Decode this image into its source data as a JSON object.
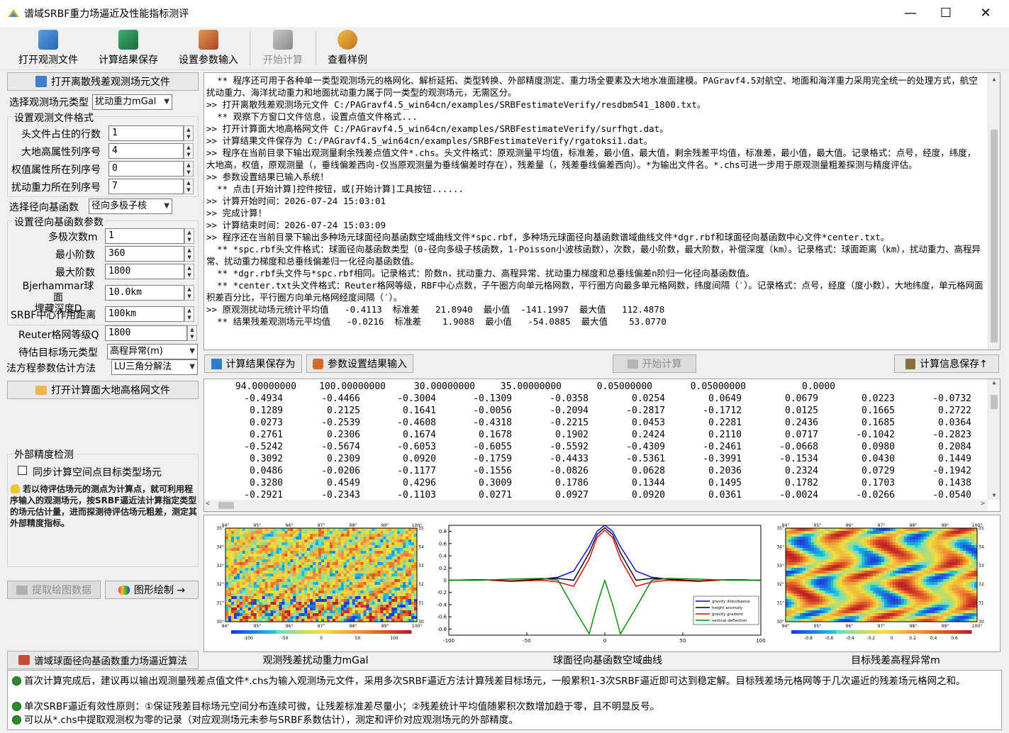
{
  "window": {
    "title": "谱域SRBF重力场逼近及性能指标测评",
    "minimize": "—",
    "maximize": "☐",
    "close": "✕"
  },
  "toolbar": {
    "items": [
      {
        "label": "打开观测文件",
        "icon": "open-file-icon",
        "enabled": true
      },
      {
        "label": "计算结果保存",
        "icon": "save-icon",
        "enabled": true
      },
      {
        "label": "设置参数输入",
        "icon": "settings-icon",
        "enabled": true
      },
      {
        "label": "开始计算",
        "icon": "computer-icon",
        "enabled": false
      },
      {
        "label": "查看样例",
        "icon": "example-icon",
        "enabled": true
      }
    ]
  },
  "left": {
    "open_residual_button": "打开离散残差观测场元文件",
    "field_type_label": "选择观测场元类型",
    "field_type_value": "扰动重力mGal",
    "format_group_title": "设置观测文件格式",
    "header_rows_label": "头文件占住的行数",
    "header_rows_value": "1",
    "height_col_label": "大地高属性列序号",
    "height_col_value": "4",
    "weight_col_label": "权值属性所在列序号",
    "weight_col_value": "0",
    "gravity_col_label": "扰动重力所在列序号",
    "gravity_col_value": "7",
    "basis_label": "选择径向基函数",
    "basis_value": "径向多极子核",
    "basis_group_title": "设置径向基函数参数",
    "multipole_label": "多极次数m",
    "multipole_value": "1",
    "min_order_label": "最小阶数",
    "min_order_value": "360",
    "max_order_label": "最大阶数",
    "max_order_value": "1800",
    "bjerhammar_label": "Bjerhammar球面\n埋藏深度D",
    "bjerhammar_value": "10.0km",
    "srbf_range_label": "SRBF中心作用距离",
    "srbf_range_value": "100km",
    "reuter_label": "Reuter格网等级Q",
    "reuter_value": "1800",
    "target_label": "待估目标场元类型",
    "target_value": "高程异常(m)",
    "method_label": "法方程参数估计方法",
    "method_value": "LU三角分解法",
    "open_grid_button": "打开计算面大地高格网文件",
    "external_group_title": "外部精度检测",
    "sync_checkbox_label": "同步计算空间点目标类型场元",
    "sync_checked": false,
    "hint": "若以待评估场元的测点为计算点，就可利用程序输入的观测场元，按SRBF逼近法计算指定类型的场元估计量，进而探测待评估场元粗差，测定其外部精度指标。",
    "extract_button": "提取绘图数据",
    "plot_button": "图形绘制 →",
    "algorithm_button": "谱域球面径向基函数重力场逼近算法"
  },
  "log": {
    "lines": [
      "  ** 程序还可用于各种单一类型观测场元的格网化、解析延拓、类型转换、外部精度测定、重力场全要素及大地水准面建模。PAGravf4.5对航空、地面和海洋重力采用完全统一的处理方式，航空扰动重力、海洋扰动重力和地面扰动重力属于同一类型的观测场元，无需区分。",
      ">> 打开离散残差观测场元文件 C:/PAGravf4.5_win64cn/examples/SRBFestimateVerify/resdbm541_1800.txt。",
      "  ** 观察下方窗口文件信息，设置点值文件格式...",
      ">> 打开计算面大地高格网文件 C:/PAGravf4.5_win64cn/examples/SRBFestimateVerify/surfhgt.dat。",
      ">> 计算结果文件保存为 C:/PAGravf4.5_win64cn/examples/SRBFestimateVerify/rgatoksi1.dat。",
      ">> 程序在当前目录下输出观测量剩余残差点值文件*.chs。头文件格式：原观测量平均值，标准差，最小值，最大值，剩余残差平均值，标准差，最小值，最大值。记录格式：点号，经度，纬度，大地高，权值，原观测量（，垂线偏差西向-仅当原观测量为垂线偏差时存在），残差量（，残差垂线偏差西向）。*为输出文件名。*.chs可进一步用于原观测量粗差探测与精度评估。",
      ">> 参数设置结果已输入系统！",
      "  ** 点击[开始计算]控件按钮，或[开始计算]工具按钮......",
      ">> 计算开始时间：2026-07-24 15:03:01",
      ">> 完成计算！",
      ">> 计算结束时间：2026-07-24 15:03:09",
      ">> 程序还在当前目录下输出多种场元球面径向基函数空域曲线文件*spc.rbf，多种场元球面径向基函数谱域曲线文件*dgr.rbf和球面径向基函数中心文件*center.txt。",
      "  ** *spc.rbf头文件格式：球面径向基函数类型（0-径向多级子核函数，1-Poisson小波核函数），次数，最小阶数，最大阶数，补偿深度（km）。记录格式：球面距离（km），扰动重力、高程异常、扰动重力梯度和总垂线偏差归一化径向基函数值。",
      "  ** *dgr.rbf头文件与*spc.rbf相同。记录格式：阶数n，扰动重力、高程异常、扰动重力梯度和总垂线偏差n阶归一化径向基函数值。",
      "  ** *center.txt头文件格式：Reuter格网等级，RBF中心点数，子午圈方向单元格网数，平行圈方向最多单元格网数，纬度间隔（′）。记录格式：点号，经度（度小数），大地纬度，单元格网面积差百分比，平行圈方向单元格网经度间隔（′）。",
      ">> 原观测扰动场元统计平均值   -0.4113  标准差   21.8940  最小值  -141.1997  最大值   112.4878",
      "  ** 结果残差观测场元平均值   -0.0216  标准差    1.9088  最小值   -54.0885  最大值    53.0770"
    ]
  },
  "midbar": {
    "save_result_button": "计算结果保存为",
    "params_input_button": "参数设置结果输入",
    "start_button": "开始计算",
    "save_info_button": "计算信息保存↑"
  },
  "grid": {
    "header": [
      "94.00000000",
      "100.00000000",
      "30.00000000",
      "35.00000000",
      "0.05000000",
      "0.05000000",
      "0.0000"
    ],
    "rows": [
      [
        "-0.4934",
        "-0.4466",
        "-0.3004",
        "-0.1309",
        "-0.0358",
        "0.0254",
        "0.0649",
        "0.0679",
        "0.0223",
        "-0.0732"
      ],
      [
        "0.1289",
        "0.2125",
        "0.1641",
        "-0.0056",
        "-0.2094",
        "-0.2817",
        "-0.1712",
        "0.0125",
        "0.1665",
        "0.2722"
      ],
      [
        "0.0273",
        "-0.2539",
        "-0.4608",
        "-0.4318",
        "-0.2215",
        "0.0453",
        "0.2281",
        "0.2436",
        "0.1685",
        "0.0364"
      ],
      [
        "0.2761",
        "0.2306",
        "0.1674",
        "0.1678",
        "0.1902",
        "0.2424",
        "0.2110",
        "0.0717",
        "-0.1042",
        "-0.2823"
      ],
      [
        "-0.5242",
        "-0.5674",
        "-0.6053",
        "-0.6055",
        "-0.5592",
        "-0.4309",
        "-0.2461",
        "-0.0668",
        "0.0980",
        "0.2084"
      ],
      [
        "0.3092",
        "0.2309",
        "0.0920",
        "-0.1759",
        "-0.4433",
        "-0.5361",
        "-0.3991",
        "-0.1534",
        "0.0430",
        "0.1449"
      ],
      [
        "0.0486",
        "-0.0206",
        "-0.1177",
        "-0.1556",
        "-0.0826",
        "0.0628",
        "0.2036",
        "0.2324",
        "0.0729",
        "-0.1942"
      ],
      [
        "0.3280",
        "0.4549",
        "0.4296",
        "0.3009",
        "0.1786",
        "0.1344",
        "0.1495",
        "0.1782",
        "0.1703",
        "0.1438"
      ],
      [
        "-0.2921",
        "-0.2343",
        "-0.1103",
        "0.0271",
        "0.0927",
        "0.0920",
        "0.0361",
        "-0.0024",
        "-0.0266",
        "-0.0540"
      ]
    ]
  },
  "plots": {
    "left_caption": "观测残差扰动重力mGal",
    "middle_caption": "球面径向基函数空域曲线",
    "right_caption": "目标残差高程异常m",
    "map_x_ticks": [
      "94°",
      "95°",
      "96°",
      "97°",
      "98°",
      "99°",
      "100°"
    ],
    "map_y_ticks": [
      "35°",
      "34°",
      "33°",
      "32°",
      "31°",
      "30°"
    ],
    "left_colorbar_ticks": [
      "-100",
      "-50",
      "0",
      "50",
      "100"
    ],
    "right_colorbar_ticks": [
      "-0.8",
      "-0.6",
      "-0.4",
      "-0.2",
      "0",
      "0.2",
      "0.4",
      "0.6"
    ]
  },
  "chart_data": {
    "type": "line",
    "xlim": [
      -100,
      100
    ],
    "ylim": [
      -0.9,
      0.9
    ],
    "x_ticks": [
      "-100",
      "-50",
      "0",
      "50",
      "100"
    ],
    "y_ticks": [
      "0.8",
      "0.6",
      "0.4",
      "0.2",
      "0",
      "-0.2",
      "-0.4",
      "-0.6",
      "-0.8"
    ],
    "legend_position": "bottom-right",
    "x": [
      -100,
      -80,
      -60,
      -40,
      -30,
      -20,
      -10,
      -5,
      0,
      5,
      10,
      20,
      30,
      40,
      60,
      80,
      100
    ],
    "series": [
      {
        "name": "gravity disturbance",
        "color": "#0000dd",
        "values": [
          0,
          0.01,
          -0.02,
          0.02,
          0.05,
          0.15,
          0.55,
          0.8,
          0.9,
          0.8,
          0.55,
          0.15,
          0.05,
          0.02,
          -0.02,
          0.01,
          0
        ]
      },
      {
        "name": "height anomaly",
        "color": "#000000",
        "values": [
          0,
          0.01,
          -0.01,
          0.02,
          0.03,
          0.0,
          0.45,
          0.75,
          0.86,
          0.75,
          0.45,
          0.0,
          0.03,
          0.02,
          -0.01,
          0.01,
          0
        ]
      },
      {
        "name": "gravity gradient",
        "color": "#dd0000",
        "values": [
          0,
          0.01,
          -0.02,
          0.0,
          -0.03,
          -0.1,
          0.35,
          0.7,
          0.82,
          0.7,
          0.35,
          -0.1,
          -0.03,
          0.0,
          -0.02,
          0.01,
          0
        ]
      },
      {
        "name": "vertical deflection",
        "color": "#008800",
        "values": [
          0,
          0.0,
          0.02,
          0.03,
          0.0,
          -0.45,
          -0.88,
          -0.4,
          0.0,
          -0.4,
          -0.88,
          -0.45,
          0.0,
          0.03,
          0.02,
          0.0,
          0
        ]
      }
    ]
  },
  "notes": [
    "首次计算完成后，建议再以输出观测量残差点值文件*.chs为输入观测场元文件，采用多次SRBF逼近方法计算残差目标场元，一般累积1-3次SRBF逼近即可达到稳定解。目标残差场元格网等于几次逼近的残差场元格网之和。",
    "单次SRBF逼近有效性原则：①保证残差目标场元空间分布连续可微，让残差标准差尽量小；②残差统计平均值随累积次数增加趋于零，且不明显反号。",
    "可以从*.chs中提取观测权为零的记录（对应观测场元未参与SRBF系数估计），测定和评价对应观测场元的外部精度。"
  ]
}
